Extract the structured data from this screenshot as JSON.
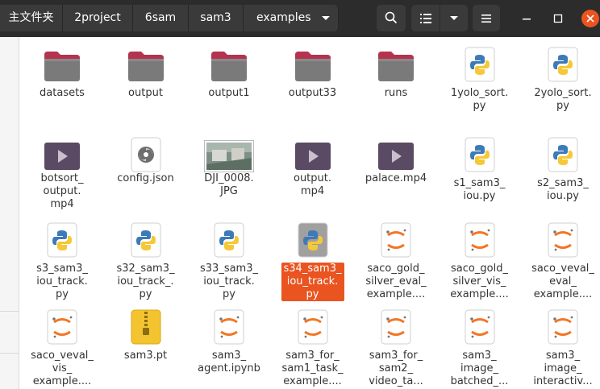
{
  "breadcrumbs": [
    "主文件夹",
    "2project",
    "6sam",
    "sam3",
    "examples"
  ],
  "icons": {
    "search": "search-icon",
    "view_list": "list-view-icon",
    "view_options": "chevron-down-icon",
    "menu": "hamburger-menu-icon",
    "minimize": "minimize-icon",
    "maximize": "maximize-icon",
    "close": "close-icon"
  },
  "colors": {
    "header": "#2c2c2c",
    "folder": "#7a7a7a",
    "folder_tab": "#b5334f",
    "selection": "#e95420",
    "close_button": "#e95420",
    "video": "#5b4a63"
  },
  "files": [
    {
      "name": "datasets",
      "type": "folder"
    },
    {
      "name": "output",
      "type": "folder"
    },
    {
      "name": "output1",
      "type": "folder"
    },
    {
      "name": "output33",
      "type": "folder"
    },
    {
      "name": "runs",
      "type": "folder"
    },
    {
      "name": "1yolo_sort.\npy",
      "type": "python"
    },
    {
      "name": "2yolo_sort.\npy",
      "type": "python"
    },
    {
      "name": "botsort_\noutput.\nmp4",
      "type": "video"
    },
    {
      "name": "config.json",
      "type": "json"
    },
    {
      "name": "DJI_0008.\nJPG",
      "type": "image"
    },
    {
      "name": "output.\nmp4",
      "type": "video"
    },
    {
      "name": "palace.mp4",
      "type": "video"
    },
    {
      "name": "s1_sam3_\niou.py",
      "type": "python"
    },
    {
      "name": "s2_sam3_\niou.py",
      "type": "python"
    },
    {
      "name": "s3_sam3_\niou_track.\npy",
      "type": "python"
    },
    {
      "name": "s32_sam3_\niou_track_.\npy",
      "type": "python"
    },
    {
      "name": "s33_sam3_\niou_track.\npy",
      "type": "python"
    },
    {
      "name": "s34_sam3_\niou_track.\npy",
      "type": "python",
      "selected": true
    },
    {
      "name": "saco_gold_\nsilver_eval_\nexample....",
      "type": "notebook"
    },
    {
      "name": "saco_gold_\nsilver_vis_\nexample....",
      "type": "notebook"
    },
    {
      "name": "saco_veval_\neval_\nexample....",
      "type": "notebook"
    },
    {
      "name": "saco_veval_\nvis_\nexample....",
      "type": "notebook"
    },
    {
      "name": "sam3.pt",
      "type": "archive"
    },
    {
      "name": "sam3_\nagent.ipynb",
      "type": "notebook"
    },
    {
      "name": "sam3_for_\nsam1_task_\nexample....",
      "type": "notebook"
    },
    {
      "name": "sam3_for_\nsam2_\nvideo_ta...",
      "type": "notebook"
    },
    {
      "name": "sam3_\nimage_\nbatched_...",
      "type": "notebook"
    },
    {
      "name": "sam3_\nimage_\ninteractiv...",
      "type": "notebook"
    }
  ]
}
